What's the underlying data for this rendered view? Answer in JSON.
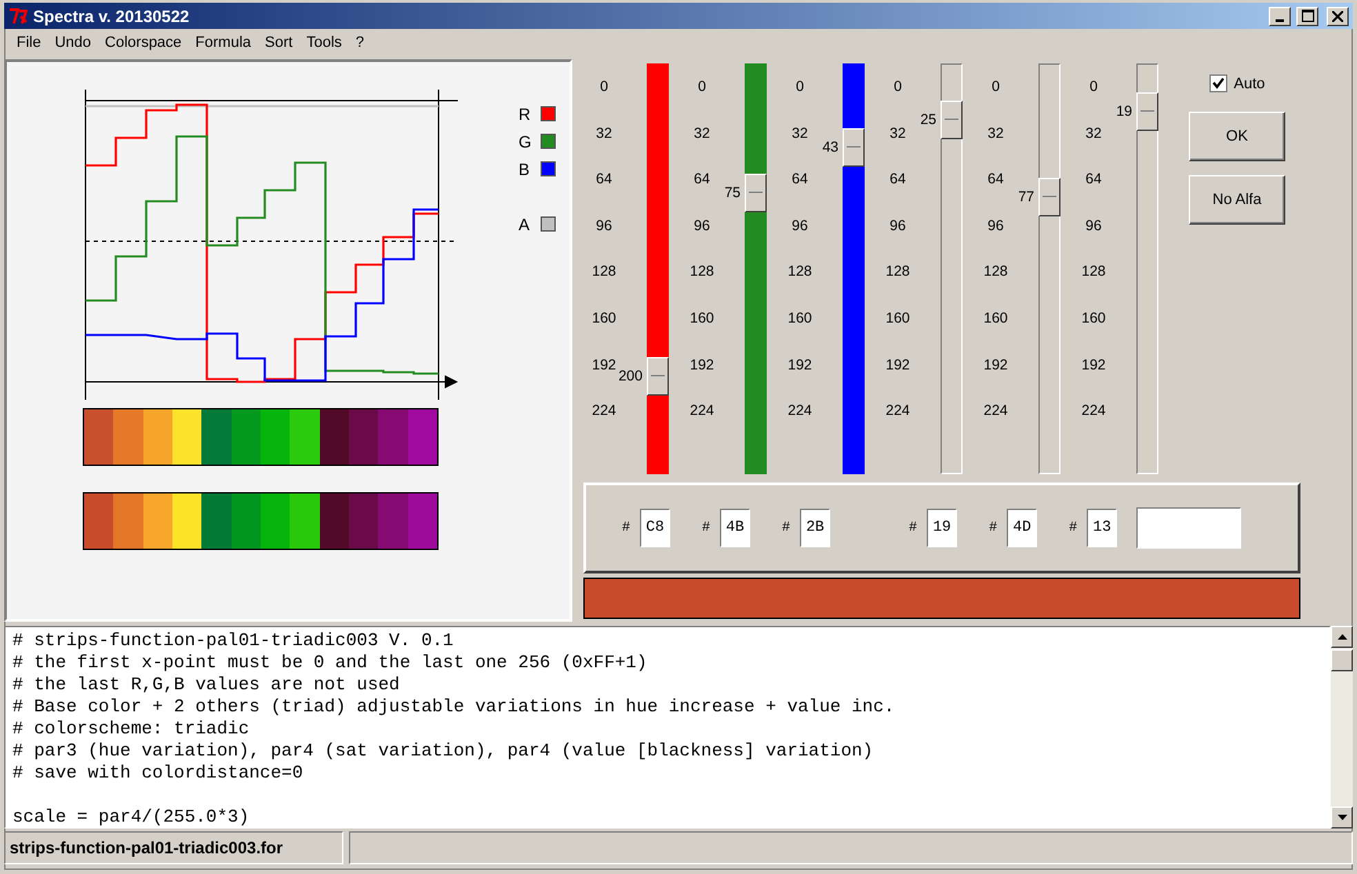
{
  "window": {
    "title": "Spectra v. 20130522"
  },
  "menu": [
    "File",
    "Undo",
    "Colorspace",
    "Formula",
    "Sort",
    "Tools",
    "?"
  ],
  "chart": {
    "legend": [
      {
        "label": "R",
        "color": "#ff0000"
      },
      {
        "label": "G",
        "color": "#228b22"
      },
      {
        "label": "B",
        "color": "#0000ff"
      },
      {
        "label": "A",
        "color": "#c0c0c0"
      }
    ]
  },
  "palette_strips": [
    {
      "swatches": [
        {
          "color": "#c8502d"
        },
        {
          "color": "#e6782a"
        },
        {
          "color": "#f5a52a"
        },
        {
          "color": "#fce22a"
        },
        {
          "color": "#047a38"
        },
        {
          "color": "#03991f"
        },
        {
          "color": "#06b50c"
        },
        {
          "color": "#2cca0c"
        },
        {
          "color": "#530a28"
        },
        {
          "color": "#6b0a48"
        },
        {
          "color": "#860a72"
        },
        {
          "color": "#a00a9e"
        }
      ]
    },
    {
      "swatches": [
        {
          "color": "#c84b2b"
        },
        {
          "color": "#e4762a"
        },
        {
          "color": "#f6a62a"
        },
        {
          "color": "#fde22a"
        },
        {
          "color": "#027a36"
        },
        {
          "color": "#02961e"
        },
        {
          "color": "#05b40a"
        },
        {
          "color": "#28c80a"
        },
        {
          "color": "#520a28"
        },
        {
          "color": "#6a0a48"
        },
        {
          "color": "#850a72"
        },
        {
          "color": "#9e0a9c"
        }
      ]
    }
  ],
  "sliders": [
    {
      "value": "200",
      "level": 0.784,
      "color": "#ff0000",
      "scale": [
        "0",
        "32",
        "64",
        "96",
        "128",
        "160",
        "192",
        "224"
      ]
    },
    {
      "value": "75",
      "level": 0.294,
      "color": "#228b22",
      "scale": [
        "0",
        "32",
        "64",
        "96",
        "128",
        "160",
        "192",
        "224"
      ]
    },
    {
      "value": "43",
      "level": 0.169,
      "color": "#0000ff",
      "scale": [
        "0",
        "32",
        "64",
        "96",
        "128",
        "160",
        "192",
        "224"
      ]
    },
    {
      "value": "25",
      "level": 0.098,
      "scale": [
        "0",
        "32",
        "64",
        "96",
        "128",
        "160",
        "192",
        "224"
      ]
    },
    {
      "value": "77",
      "level": 0.302,
      "scale": [
        "0",
        "32",
        "64",
        "96",
        "128",
        "160",
        "192",
        "224"
      ]
    },
    {
      "value": "19",
      "level": 0.075,
      "scale": [
        "0",
        "32",
        "64",
        "96",
        "128",
        "160",
        "192",
        "224"
      ]
    }
  ],
  "auto": {
    "label": "Auto",
    "checked": true
  },
  "buttons": [
    "OK",
    "No Alfa"
  ],
  "hex_fields": [
    {
      "prefix": "#",
      "value": "C8"
    },
    {
      "prefix": "#",
      "value": "4B"
    },
    {
      "prefix": "#",
      "value": "2B"
    },
    {
      "prefix": "#",
      "value": "19"
    },
    {
      "prefix": "#",
      "value": "4D"
    },
    {
      "prefix": "#",
      "value": "13"
    }
  ],
  "preview": {
    "color": "#c84b2b"
  },
  "script": {
    "text": "# strips-function-pal01-triadic003 V. 0.1\n# the first x-point must be 0 and the last one 256 (0xFF+1)\n# the last R,G,B values are not used\n# Base color + 2 others (triad) adjustable variations in hue increase + value inc.\n# colorscheme: triadic\n# par3 (hue variation), par4 (sat variation), par4 (value [blackness] variation)\n# save with colordistance=0\n\nscale = par4/(255.0*3)"
  },
  "status_bar": {
    "file": "strips-function-pal01-triadic003.for"
  }
}
